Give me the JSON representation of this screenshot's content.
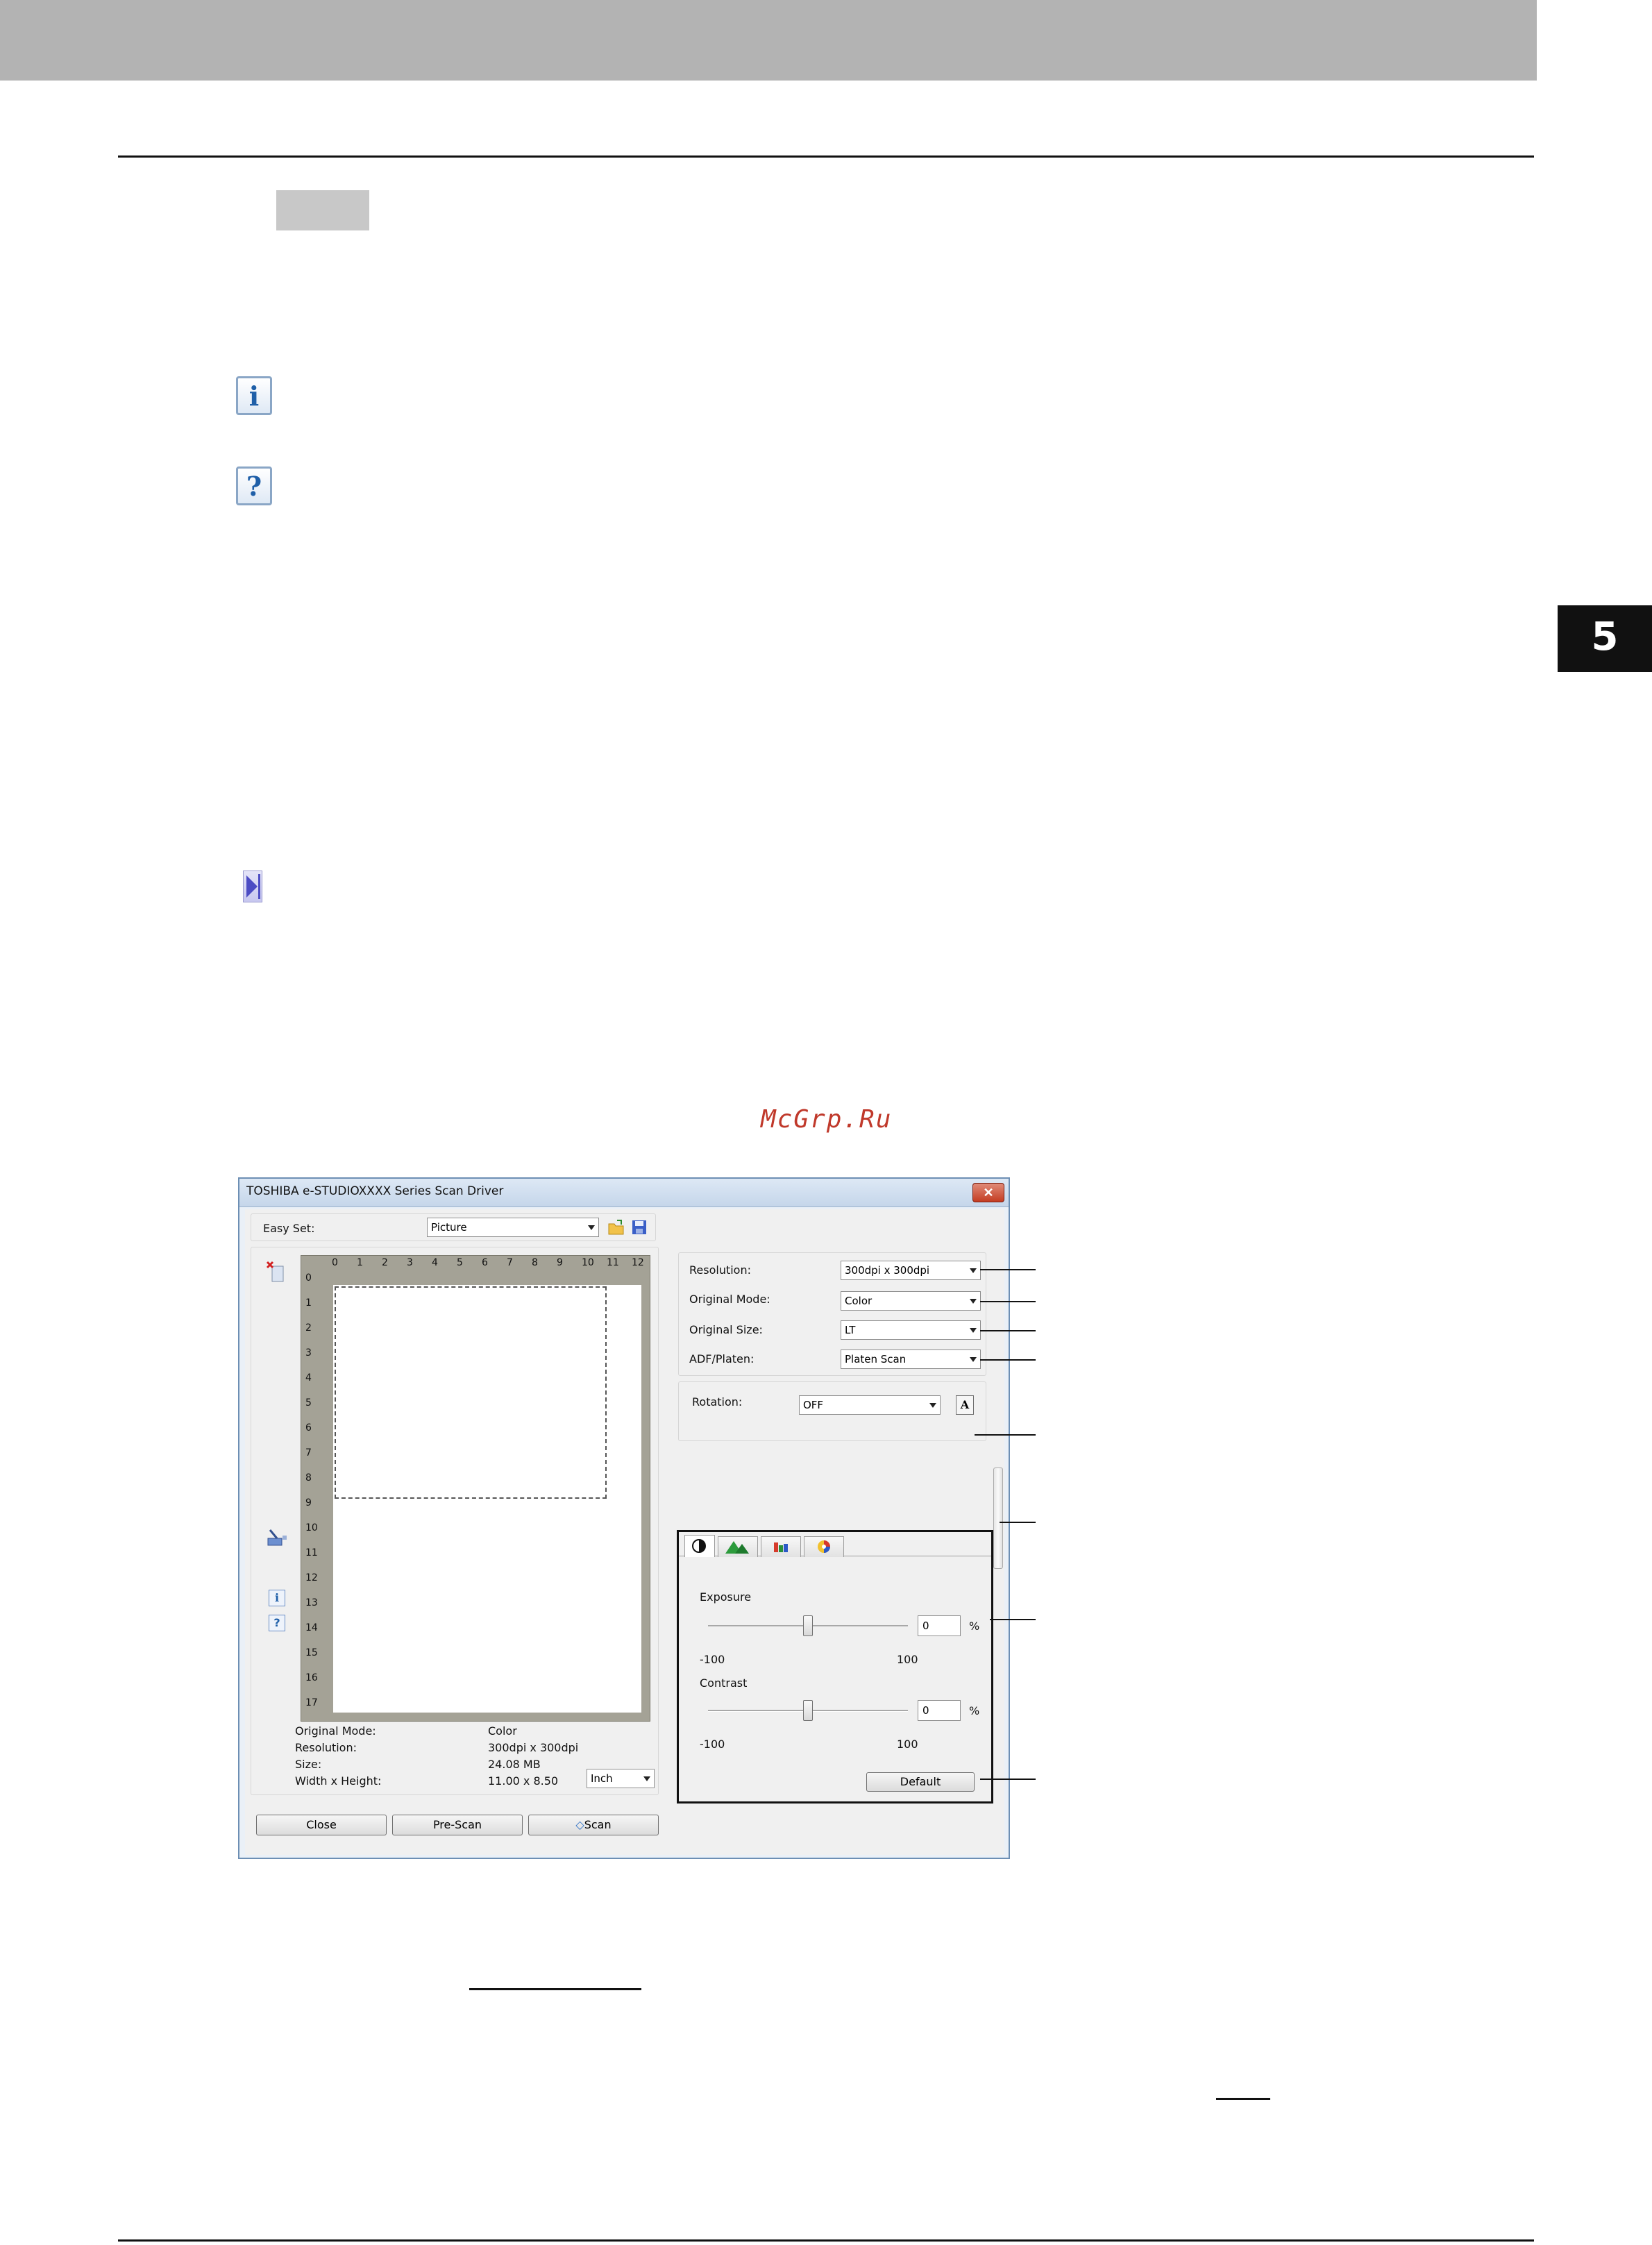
{
  "page": {
    "chapter_number": "5",
    "watermark": "McGrp.Ru"
  },
  "window": {
    "title": "TOSHIBA e-STUDIOXXXX Series Scan Driver",
    "close_glyph": "✕",
    "easy_set": {
      "label": "Easy Set:",
      "value": "Picture"
    },
    "ruler": {
      "x": [
        "0",
        "1",
        "2",
        "3",
        "4",
        "5",
        "6",
        "7",
        "8",
        "9",
        "10",
        "11",
        "12"
      ],
      "y": [
        "0",
        "1",
        "2",
        "3",
        "4",
        "5",
        "6",
        "7",
        "8",
        "9",
        "10",
        "11",
        "12",
        "13",
        "14",
        "15",
        "16",
        "17"
      ]
    },
    "info": {
      "rows": [
        {
          "label": "Original Mode:",
          "value": "Color"
        },
        {
          "label": "Resolution:",
          "value": "300dpi x 300dpi"
        },
        {
          "label": "Size:",
          "value": "24.08 MB"
        },
        {
          "label": "Width x Height:",
          "value": "11.00 x 8.50"
        }
      ],
      "unit": "Inch"
    },
    "buttons": {
      "close": "Close",
      "prescan": "Pre-Scan",
      "scan": "Scan"
    },
    "settings": [
      {
        "label": "Resolution:",
        "value": "300dpi x 300dpi"
      },
      {
        "label": "Original Mode:",
        "value": "Color"
      },
      {
        "label": "Original Size:",
        "value": "LT"
      },
      {
        "label": "ADF/Platen:",
        "value": "Platen Scan"
      }
    ],
    "rotation": {
      "label": "Rotation:",
      "value": "OFF",
      "button_glyph": "A"
    },
    "adjust": {
      "exposure": {
        "label": "Exposure",
        "value": "0",
        "unit": "%",
        "min": "-100",
        "max": "100",
        "level": 0
      },
      "contrast": {
        "label": "Contrast",
        "value": "0",
        "unit": "%",
        "min": "-100",
        "max": "100",
        "level": 0
      },
      "default_button": "Default"
    }
  }
}
